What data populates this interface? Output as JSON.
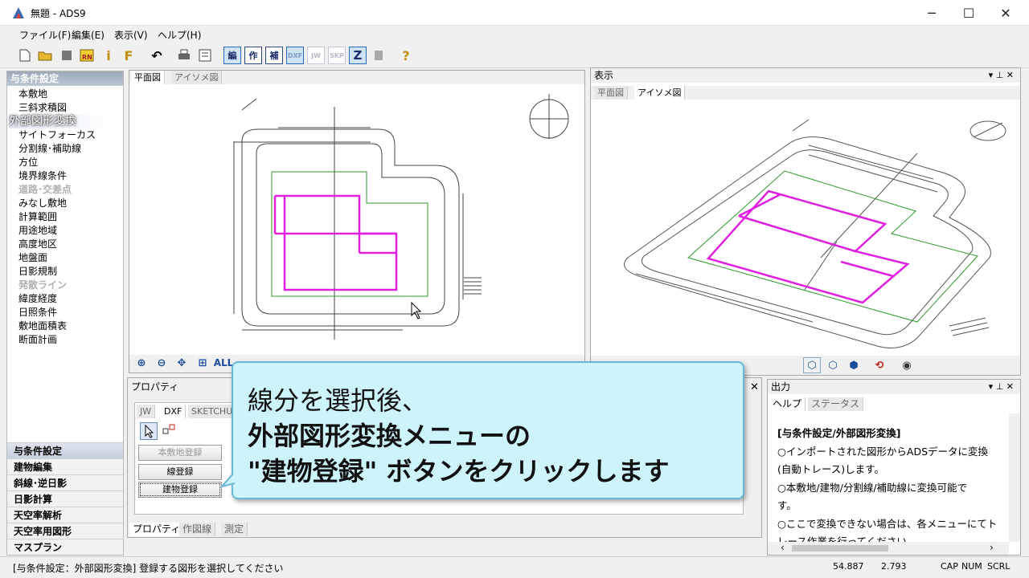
{
  "window": {
    "title": "無題 - ADS9",
    "min": "─",
    "max": "☐",
    "close": "✕"
  },
  "menu": [
    "ファイル(F)",
    "編集(E)",
    "表示(V)",
    "ヘルプ(H)"
  ],
  "toolbar": {
    "text_buttons": [
      "編",
      "作",
      "補",
      "DXF",
      "JW",
      "SKP",
      "Z"
    ],
    "help": "?"
  },
  "left_panel": {
    "header": "与条件設定",
    "items": [
      "本敷地",
      "三斜求積図",
      "外部図形変換",
      "サイトフォーカス",
      "分割線･補助線",
      "方位",
      "境界線条件",
      "道路･交差点",
      "みなし敷地",
      "計算範囲",
      "用途地域",
      "高度地区",
      "地盤面",
      "日影規制",
      "発散ライン",
      "緯度経度",
      "日照条件",
      "敷地面積表",
      "断面計画"
    ],
    "categories": [
      "与条件設定",
      "建物編集",
      "斜線･逆日影",
      "日影計算",
      "天空率解析",
      "天空率用図形",
      "マスプラン"
    ]
  },
  "plan_view": {
    "tabs": [
      "平面図",
      "アイソメ図"
    ],
    "zoom_all": "ALL"
  },
  "display_view": {
    "title": "表示",
    "tabs": [
      "平面図",
      "アイソメ図"
    ],
    "pin": "▾ ⊥ ✕"
  },
  "properties": {
    "title": "プロパティ",
    "tabs": [
      "JW",
      "DXF",
      "SKETCHUP"
    ],
    "buttons": [
      "本敷地登録",
      "線登録",
      "建物登録"
    ],
    "bottom_tabs": [
      "プロパティ",
      "作図線",
      "測定"
    ]
  },
  "output": {
    "title": "出力",
    "tabs": [
      "ヘルプ",
      "ステータス"
    ],
    "lines": [
      "[与条件設定/外部図形変換]",
      "○インポートされた図形からADSデータに変換",
      "(自動トレース)します。",
      "○本敷地/建物/分割線/補助線に変換可能で",
      "す。",
      "○ここで変換できない場合は、各メニューにてト",
      "レース作業を行ってください。"
    ]
  },
  "callout": {
    "lines": [
      "線分を選択後、",
      "外部図形変換メニューの",
      "\"建物登録\" ボタンをクリックします"
    ]
  },
  "status": {
    "message": "[与条件設定：外部図形変換] 登録する図形を選択してください",
    "x": "54.887",
    "y": "2.793",
    "cap": "CAP",
    "num": "NUM",
    "scrl": "SCRL"
  },
  "colors": {
    "building": "#e020e0",
    "site": "#2a9a2a",
    "accent": "#2a6ac0"
  }
}
